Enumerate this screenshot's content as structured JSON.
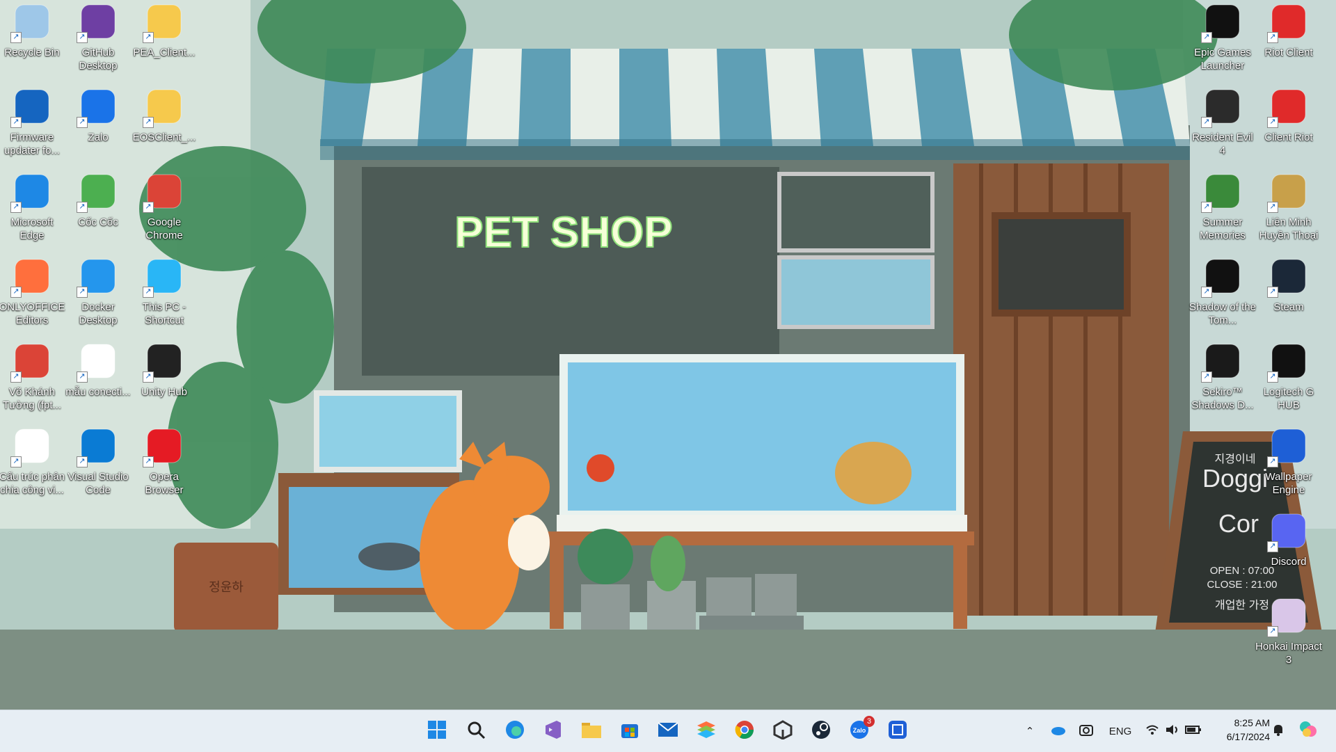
{
  "wallpaper": {
    "sign_text": "PET SHOP",
    "chalkboard_lines": [
      "지경이네",
      "Doggi",
      "Cor",
      "OPEN : 07:00",
      "CLOSE : 21:00",
      "개업한 가정"
    ],
    "pot_text": "정윤하"
  },
  "desktop_icons_left": [
    {
      "label": "Recycle Bin",
      "icon": "recycle-bin-icon",
      "color": "#9ec7e8"
    },
    {
      "label": "GitHub Desktop",
      "icon": "github-icon",
      "color": "#6e3fa3"
    },
    {
      "label": "PEA_Client...",
      "icon": "folder-icon",
      "color": "#f6c94c"
    },
    {
      "label": "Firmware updater fo...",
      "icon": "gamepad-icon",
      "color": "#1565c0"
    },
    {
      "label": "Zalo",
      "icon": "zalo-icon",
      "color": "#1a73e8"
    },
    {
      "label": "EOSClient_...",
      "icon": "folder-icon",
      "color": "#f6c94c"
    },
    {
      "label": "Microsoft Edge",
      "icon": "edge-icon",
      "color": "#1e88e5"
    },
    {
      "label": "Cốc Cốc",
      "icon": "coccoc-icon",
      "color": "#4caf50"
    },
    {
      "label": "Google Chrome",
      "icon": "chrome-icon",
      "color": "#db4437"
    },
    {
      "label": "ONLYOFFICE Editors",
      "icon": "onlyoffice-icon",
      "color": "#ff6f3d"
    },
    {
      "label": "Docker Desktop",
      "icon": "docker-icon",
      "color": "#2496ed"
    },
    {
      "label": "This PC - Shortcut",
      "icon": "monitor-icon",
      "color": "#29b6f6"
    },
    {
      "label": "Võ Khánh Tường (fpt...",
      "icon": "chrome-profile-icon",
      "color": "#db4437"
    },
    {
      "label": "mẫu conecti...",
      "icon": "document-icon",
      "color": "#ffffff"
    },
    {
      "label": "Unity Hub",
      "icon": "unity-icon",
      "color": "#222222"
    },
    {
      "label": "Cấu trúc phân chia công vi...",
      "icon": "document-icon",
      "color": "#ffffff"
    },
    {
      "label": "Visual Studio Code",
      "icon": "vscode-icon",
      "color": "#0a7bd4"
    },
    {
      "label": "Opera Browser",
      "icon": "opera-icon",
      "color": "#e51b24"
    }
  ],
  "desktop_icons_right": [
    {
      "label": "Epic Games Launcher",
      "icon": "epic-games-icon",
      "color": "#111111"
    },
    {
      "label": "Riot Client",
      "icon": "riot-icon",
      "color": "#e02a2a"
    },
    {
      "label": "Resident Evil 4",
      "icon": "resident-evil-icon",
      "color": "#2b2b2b"
    },
    {
      "label": "Client Riot",
      "icon": "riot-icon",
      "color": "#e02a2a"
    },
    {
      "label": "Summer Memories",
      "icon": "tree-icon",
      "color": "#3a8a3a"
    },
    {
      "label": "Liên Minh Huyền Thoại",
      "icon": "lol-icon",
      "color": "#c8a04a"
    },
    {
      "label": "Shadow of the Tom...",
      "icon": "tomb-raider-icon",
      "color": "#111111"
    },
    {
      "label": "Steam",
      "icon": "steam-icon",
      "color": "#1b2838"
    },
    {
      "label": "Sekiro™ Shadows D...",
      "icon": "sekiro-icon",
      "color": "#1a1a1a"
    },
    {
      "label": "Logitech G HUB",
      "icon": "logitech-icon",
      "color": "#111111"
    },
    {
      "label": "Wallpaper Engine",
      "icon": "wallpaper-engine-icon",
      "color": "#1e5fd6"
    },
    {
      "label": "Discord",
      "icon": "discord-icon",
      "color": "#5865f2"
    },
    {
      "label": "Honkai Impact 3",
      "icon": "honkai-icon",
      "color": "#d9c6e8"
    }
  ],
  "taskbar": {
    "apps": [
      {
        "name": "start-button",
        "icon": "windows-icon"
      },
      {
        "name": "search-button",
        "icon": "search-icon"
      },
      {
        "name": "taskbar-edge",
        "icon": "edge-icon"
      },
      {
        "name": "taskbar-visual-studio",
        "icon": "visual-studio-icon"
      },
      {
        "name": "taskbar-file-explorer",
        "icon": "folder-icon"
      },
      {
        "name": "taskbar-store",
        "icon": "store-icon"
      },
      {
        "name": "taskbar-mail",
        "icon": "mail-icon"
      },
      {
        "name": "taskbar-onlyoffice",
        "icon": "onlyoffice-icon"
      },
      {
        "name": "taskbar-chrome",
        "icon": "chrome-icon"
      },
      {
        "name": "taskbar-unity",
        "icon": "unity-icon"
      },
      {
        "name": "taskbar-steam",
        "icon": "steam-icon"
      },
      {
        "name": "taskbar-zalo",
        "icon": "zalo-icon"
      },
      {
        "name": "taskbar-wallpaper-engine",
        "icon": "wallpaper-engine-icon"
      }
    ],
    "zalo_badge": "3",
    "tray": {
      "language": "ENG",
      "time": "8:25 AM",
      "date": "6/17/2024"
    }
  }
}
